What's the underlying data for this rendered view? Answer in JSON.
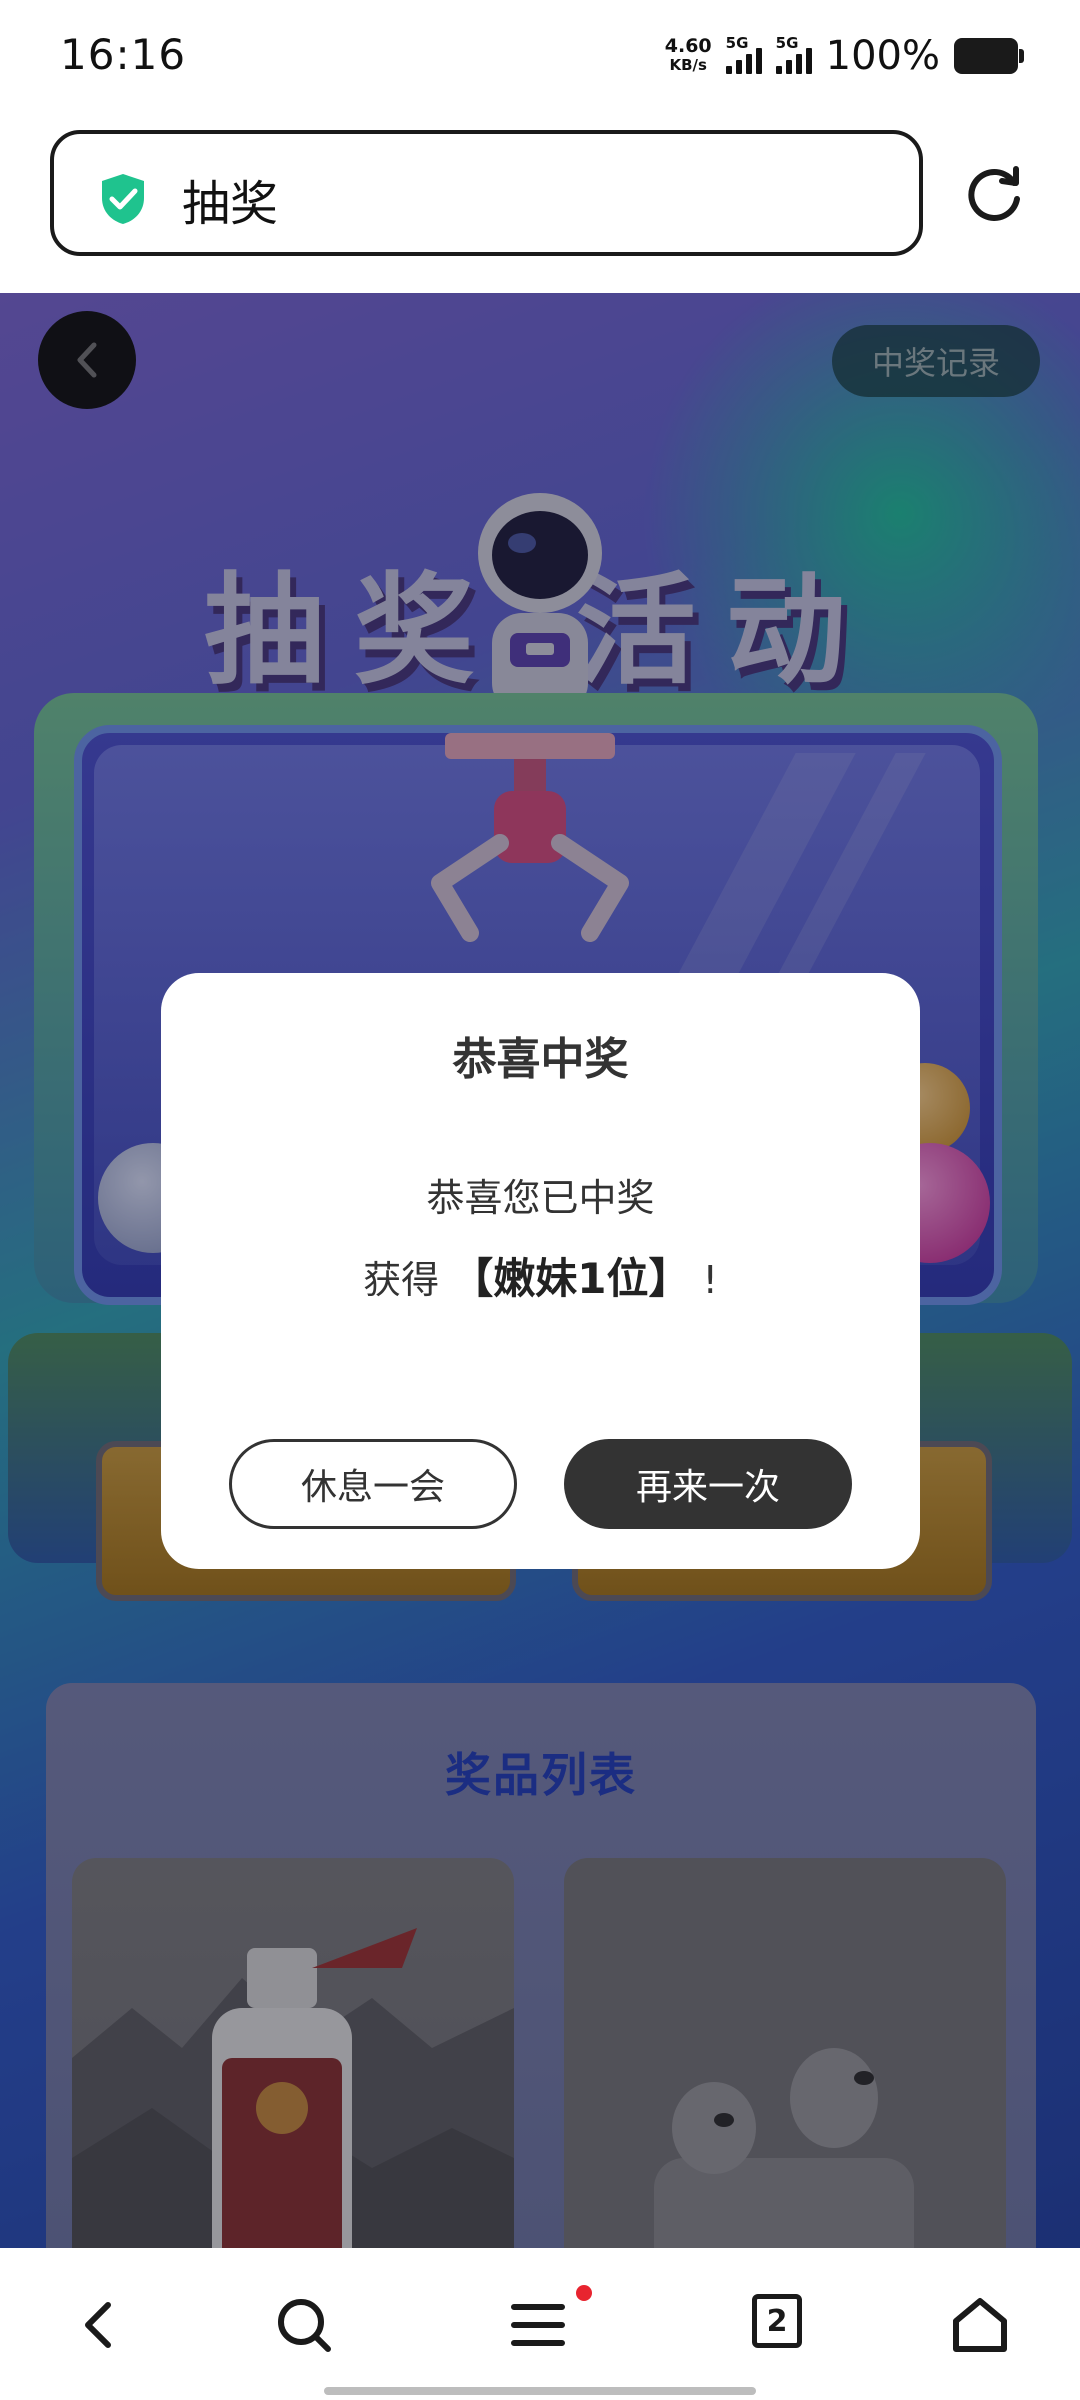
{
  "status_bar": {
    "time": "16:16",
    "net_speed_value": "4.60",
    "net_speed_unit": "KB/s",
    "sim1_label": "5G",
    "sim2_label": "5G",
    "battery_percent": "100%"
  },
  "address_bar": {
    "title": "抽奖",
    "secure_icon": "shield-check-icon",
    "refresh_icon": "refresh-icon"
  },
  "page": {
    "back_icon": "chevron-left-icon",
    "record_button": "中奖记录",
    "event_title": "抽奖  活动",
    "prize_list_title": "奖品列表"
  },
  "dialog": {
    "title": "恭喜中奖",
    "line1": "恭喜您已中奖",
    "line2_prefix": "获得",
    "prize_name": "【嫩妹1位】",
    "line2_suffix": "!",
    "rest_button": "休息一会",
    "again_button": "再来一次"
  },
  "bottom_nav": {
    "back_icon": "back-arrow-icon",
    "search_icon": "search-icon",
    "menu_icon": "menu-icon",
    "tab_count": "2",
    "home_icon": "home-icon"
  },
  "colors": {
    "shield": "#1fc38e",
    "dialog_primary": "#333333",
    "prize_title": "#1f3dbd",
    "notification_dot": "#e8242f"
  }
}
